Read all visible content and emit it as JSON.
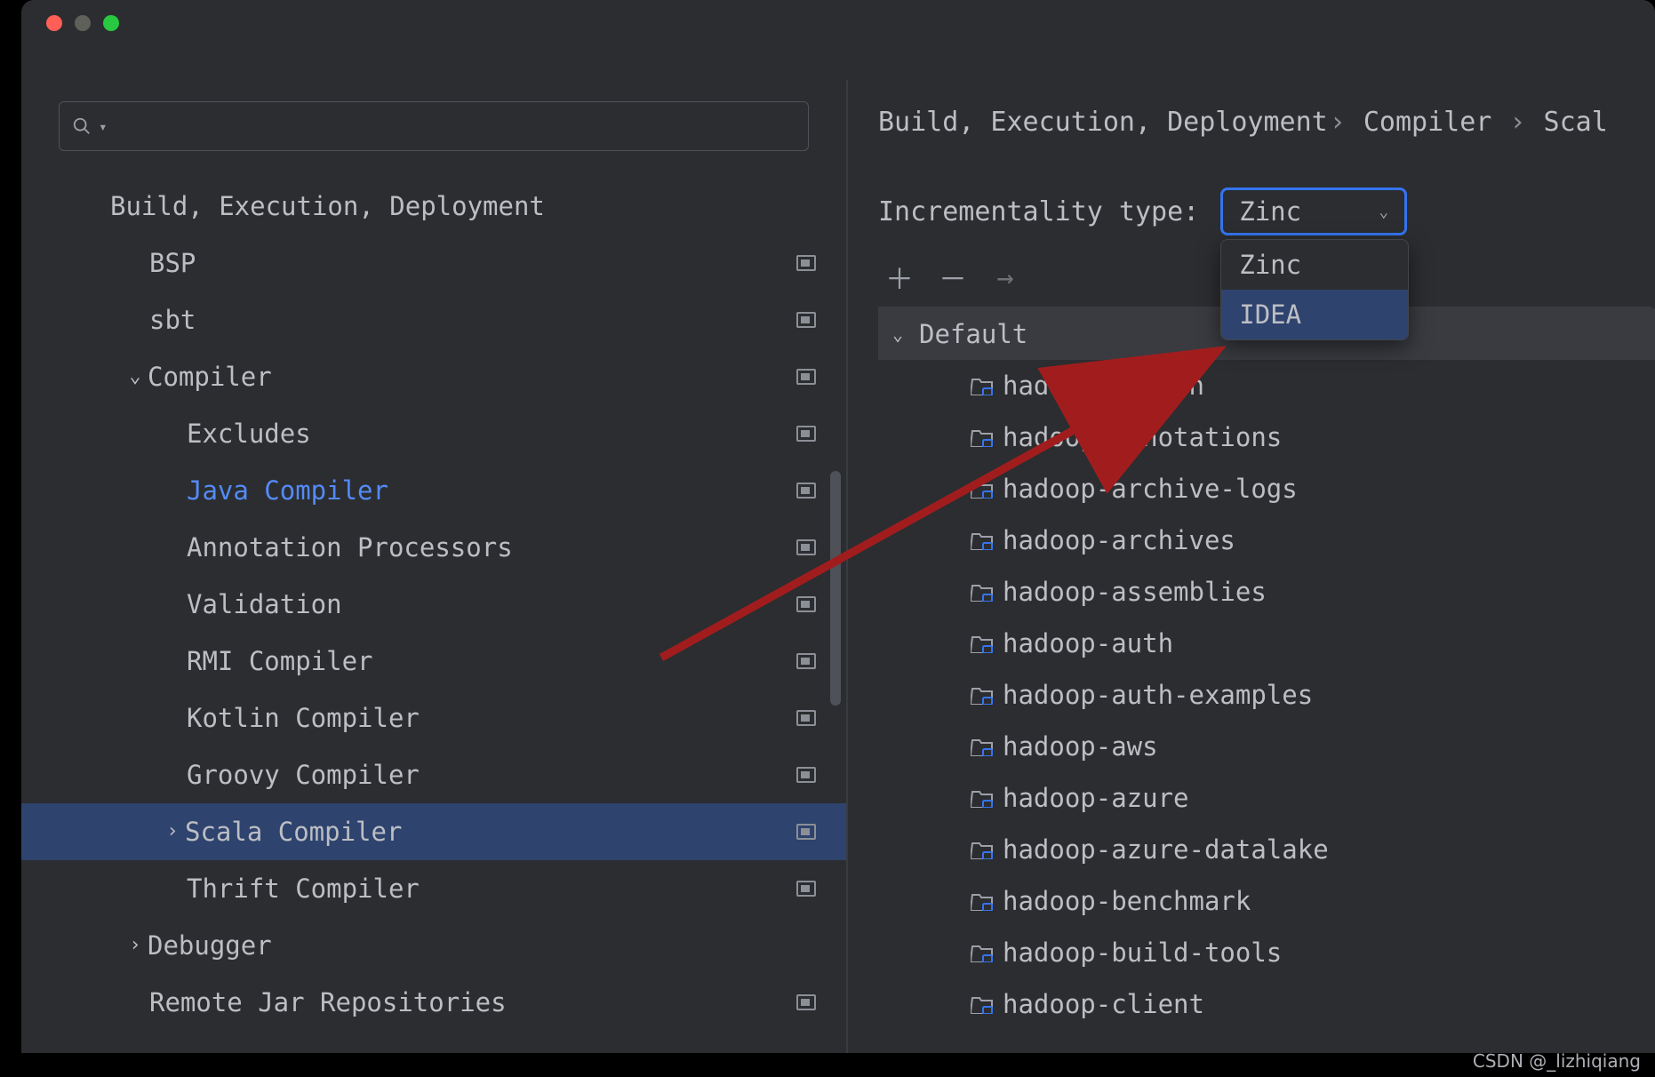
{
  "breadcrumb": {
    "part1": "Build, Execution, Deployment",
    "part2": "Compiler",
    "part3": "Scal"
  },
  "settings_tree": {
    "root_label": "Build, Execution, Deployment",
    "items": [
      {
        "label": "BSP",
        "badge": true,
        "indent": 1
      },
      {
        "label": "sbt",
        "badge": true,
        "indent": 1
      },
      {
        "label": "Compiler",
        "badge": true,
        "indent": 1,
        "chevron": "down"
      },
      {
        "label": "Excludes",
        "badge": true,
        "indent": 2
      },
      {
        "label": "Java Compiler",
        "badge": true,
        "indent": 2,
        "link": true
      },
      {
        "label": "Annotation Processors",
        "badge": true,
        "indent": 2
      },
      {
        "label": "Validation",
        "badge": true,
        "indent": 2
      },
      {
        "label": "RMI Compiler",
        "badge": true,
        "indent": 2
      },
      {
        "label": "Kotlin Compiler",
        "badge": true,
        "indent": 2
      },
      {
        "label": "Groovy Compiler",
        "badge": true,
        "indent": 2
      },
      {
        "label": "Scala Compiler",
        "badge": true,
        "indent": 2,
        "chevron": "right",
        "selected": true
      },
      {
        "label": "Thrift Compiler",
        "badge": true,
        "indent": 2
      },
      {
        "label": "Debugger",
        "badge": false,
        "indent": 1,
        "chevron": "right"
      },
      {
        "label": "Remote Jar Repositories",
        "badge": true,
        "indent": 1
      }
    ]
  },
  "incrementality": {
    "label": "Incrementality type:",
    "selected": "Zinc",
    "options": [
      "Zinc",
      "IDEA"
    ],
    "highlighted_index": 1
  },
  "profiles": {
    "default_label": "Default",
    "modules": [
      "hadoop-aliyun",
      "hadoop-annotations",
      "hadoop-archive-logs",
      "hadoop-archives",
      "hadoop-assemblies",
      "hadoop-auth",
      "hadoop-auth-examples",
      "hadoop-aws",
      "hadoop-azure",
      "hadoop-azure-datalake",
      "hadoop-benchmark",
      "hadoop-build-tools",
      "hadoop-client"
    ]
  },
  "watermark": "CSDN @_lizhiqiang"
}
